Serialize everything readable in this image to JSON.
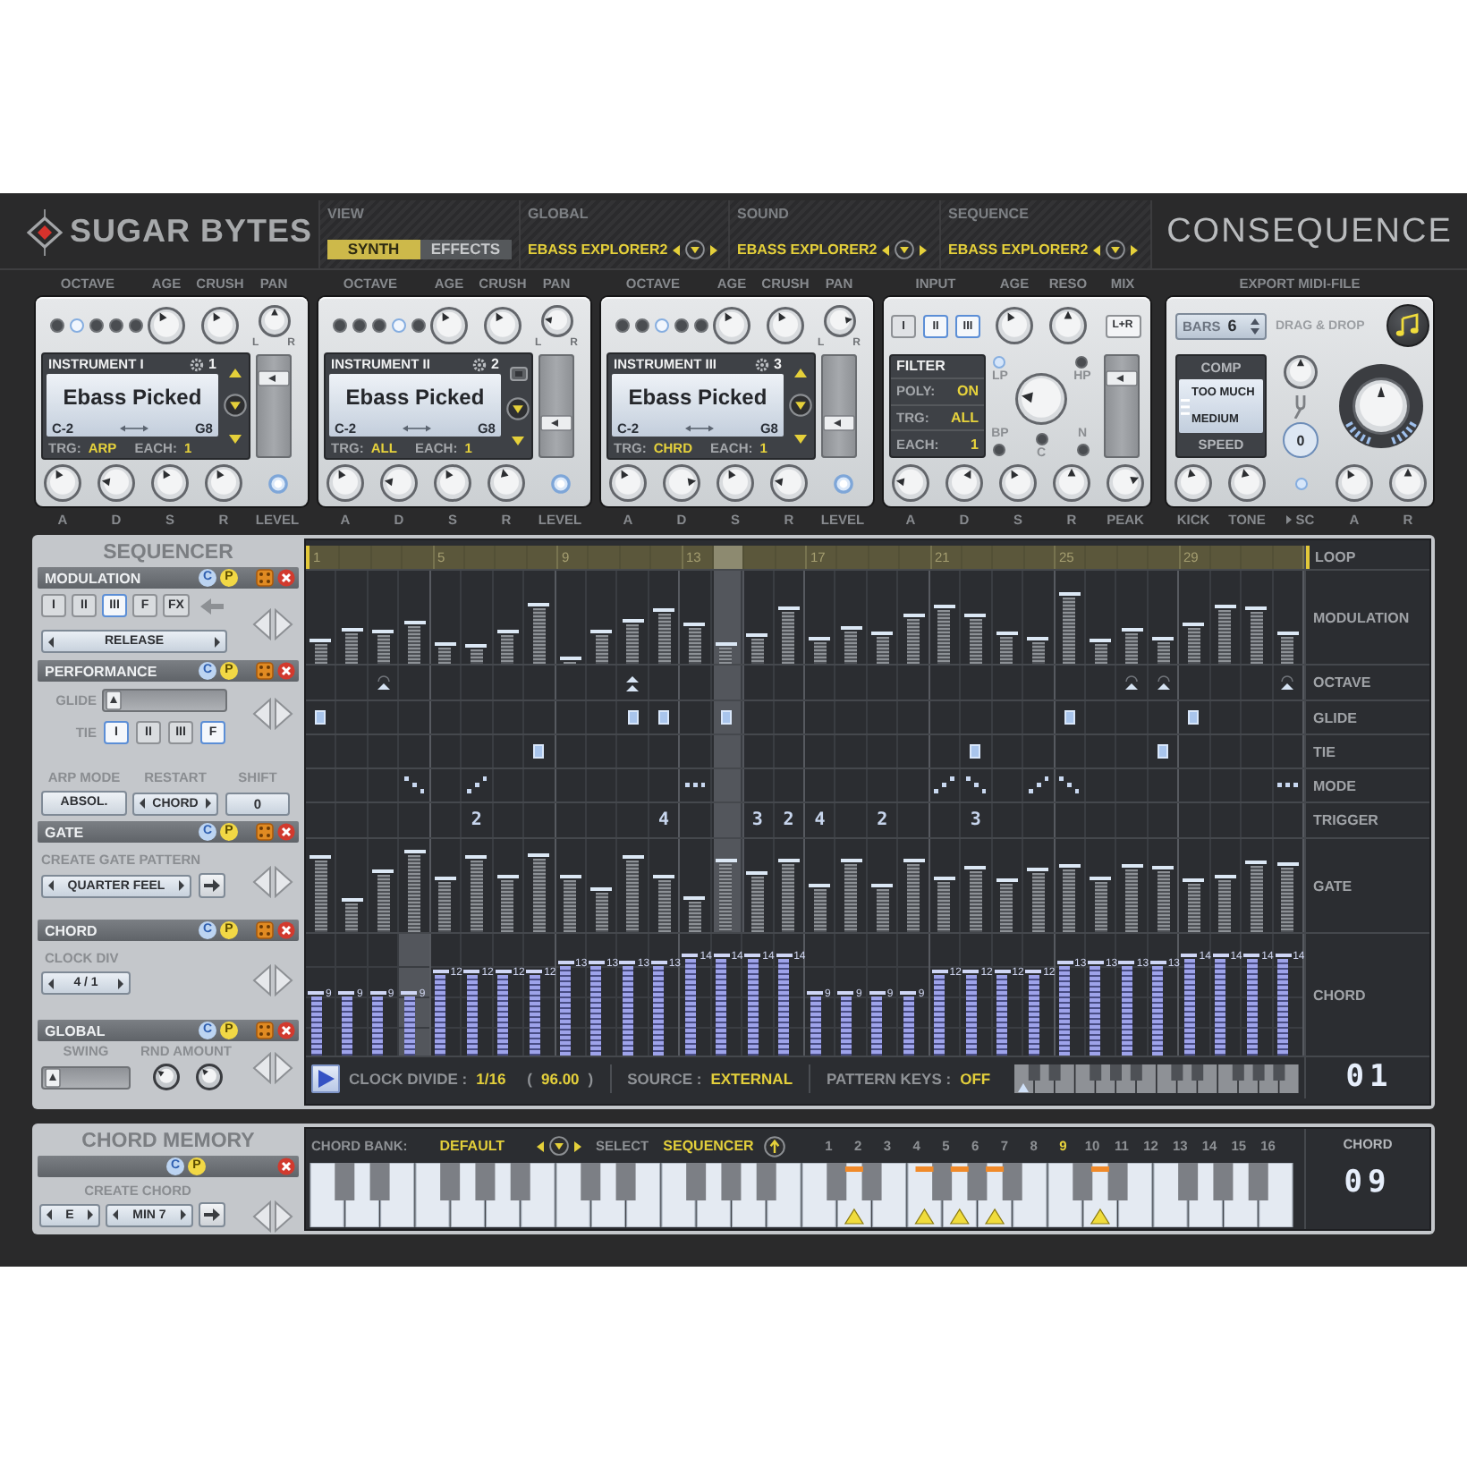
{
  "header": {
    "brand": "SUGAR BYTES",
    "view": {
      "label": "VIEW",
      "tabs": [
        {
          "label": "SYNTH",
          "selected": true
        },
        {
          "label": "EFFECTS",
          "selected": false
        }
      ]
    },
    "presets": [
      {
        "label": "GLOBAL",
        "value": "EBASS EXPLORER2"
      },
      {
        "label": "SOUND",
        "value": "EBASS EXPLORER2"
      },
      {
        "label": "SEQUENCE",
        "value": "EBASS EXPLORER2"
      }
    ],
    "product": "CONSEQUENCE"
  },
  "instruments": [
    {
      "octave_label": "OCTAVE",
      "octave_leds": [
        {
          "selected": false
        },
        {
          "selected": true
        },
        {
          "selected": false
        },
        {
          "selected": false
        },
        {
          "selected": false
        }
      ],
      "top_knobs": [
        {
          "label": "AGE",
          "level": 0.4
        },
        {
          "label": "CRUSH",
          "level": 0.4
        },
        {
          "label": "PAN",
          "level": 0.5,
          "left": "L",
          "right": "R"
        }
      ],
      "name": "INSTRUMENT I",
      "channel": "1",
      "patch": "Ebass Picked",
      "range_low": "C-2",
      "range_high": "G8",
      "trg_label": "TRG:",
      "trg": "ARP",
      "each_label": "EACH:",
      "each": "1",
      "scroll_up_enabled": true,
      "level": 0.85,
      "level_label": "LEVEL",
      "bottom_knobs": [
        {
          "label": "A",
          "level": 0.4
        },
        {
          "label": "D",
          "level": 0.2
        },
        {
          "label": "S",
          "level": 0.4
        },
        {
          "label": "R",
          "level": 0.4
        }
      ]
    },
    {
      "octave_label": "OCTAVE",
      "octave_leds": [
        {
          "selected": false
        },
        {
          "selected": false
        },
        {
          "selected": false
        },
        {
          "selected": true
        },
        {
          "selected": false
        }
      ],
      "top_knobs": [
        {
          "label": "AGE",
          "level": 0.4
        },
        {
          "label": "CRUSH",
          "level": 0.4
        },
        {
          "label": "PAN",
          "level": 0.2,
          "left": "L",
          "right": "R"
        }
      ],
      "name": "INSTRUMENT II",
      "channel": "2",
      "patch": "Ebass Picked",
      "range_low": "C-2",
      "range_high": "G8",
      "trg_label": "TRG:",
      "trg": "ALL",
      "each_label": "EACH:",
      "each": "1",
      "scroll_up_enabled": false,
      "level": 0.3,
      "level_label": "LEVEL",
      "bottom_knobs": [
        {
          "label": "A",
          "level": 0.4
        },
        {
          "label": "D",
          "level": 0.2
        },
        {
          "label": "S",
          "level": 0.4
        },
        {
          "label": "R",
          "level": 0.45
        }
      ]
    },
    {
      "octave_label": "OCTAVE",
      "octave_leds": [
        {
          "selected": false
        },
        {
          "selected": false
        },
        {
          "selected": true
        },
        {
          "selected": false
        },
        {
          "selected": false
        }
      ],
      "top_knobs": [
        {
          "label": "AGE",
          "level": 0.4
        },
        {
          "label": "CRUSH",
          "level": 0.4
        },
        {
          "label": "PAN",
          "level": 0.8,
          "left": "L",
          "right": "R"
        }
      ],
      "name": "INSTRUMENT III",
      "channel": "3",
      "patch": "Ebass Picked",
      "range_low": "C-2",
      "range_high": "G8",
      "trg_label": "TRG:",
      "trg": "CHRD",
      "each_label": "EACH:",
      "each": "1",
      "scroll_up_enabled": true,
      "level": 0.3,
      "level_label": "LEVEL",
      "bottom_knobs": [
        {
          "label": "A",
          "level": 0.4
        },
        {
          "label": "D",
          "level": 0.8
        },
        {
          "label": "S",
          "level": 0.4
        },
        {
          "label": "R",
          "level": 0.2
        }
      ]
    }
  ],
  "filter": {
    "input_label": "INPUT",
    "inputs": [
      {
        "label": "I",
        "selected": false
      },
      {
        "label": "II",
        "selected": true
      },
      {
        "label": "III",
        "selected": true
      }
    ],
    "top_knobs": [
      {
        "label": "AGE",
        "level": 0.4
      },
      {
        "label": "RESO",
        "level": 0.5
      }
    ],
    "mix_label": "MIX",
    "mix_button": "L+R",
    "title": "FILTER",
    "rows": [
      {
        "label": "POLY:",
        "value": "ON"
      },
      {
        "label": "TRG:",
        "value": "ALL"
      },
      {
        "label": "EACH:",
        "value": "1"
      }
    ],
    "modes": [
      {
        "label": "LP",
        "on": true
      },
      {
        "label": "HP",
        "on": false
      },
      {
        "label": "BP",
        "on": false
      },
      {
        "label": "N",
        "on": false
      },
      {
        "label": "C",
        "on": false
      }
    ],
    "cutoff": {
      "level": 0.2
    },
    "mix": {
      "level": 0.85
    },
    "bottom_knobs": [
      {
        "label": "A",
        "level": 0.2
      },
      {
        "label": "D",
        "level": 0.6
      },
      {
        "label": "S",
        "level": 0.4
      },
      {
        "label": "R",
        "level": 0.5
      },
      {
        "label": "PEAK",
        "level": 0.75
      }
    ]
  },
  "export": {
    "title": "EXPORT MIDI-FILE",
    "bars_label": "BARS",
    "bars": "6",
    "drag_label": "DRAG & DROP",
    "comp_label": "COMP",
    "comp": "TOO MUCH",
    "speed": "MEDIUM",
    "speed_label": "SPEED",
    "tune": {
      "level": 0.5
    },
    "tune_value": "0",
    "drive": {
      "level": 0.5
    },
    "bottom": [
      {
        "kind": "knob",
        "label": "KICK",
        "level": 0.45
      },
      {
        "kind": "knob",
        "label": "TONE",
        "level": 0.45
      },
      {
        "kind": "led",
        "label": "SC",
        "on": true
      },
      {
        "kind": "knob",
        "label": "A",
        "level": 0.4
      },
      {
        "kind": "knob",
        "label": "R",
        "level": 0.5
      }
    ]
  },
  "sequencer": {
    "title": "SEQUENCER",
    "sections": [
      {
        "kind": "modulation",
        "title": "MODULATION",
        "copy": "C",
        "paste": "P",
        "targets": [
          {
            "label": "I",
            "selected": false
          },
          {
            "label": "II",
            "selected": false
          },
          {
            "label": "III",
            "selected": true
          },
          {
            "label": "F",
            "selected": false
          },
          {
            "label": "FX",
            "selected": false
          }
        ],
        "parameter": "RELEASE"
      },
      {
        "kind": "performance",
        "title": "PERFORMANCE",
        "copy": "C",
        "paste": "P",
        "glide": {
          "label": "GLIDE",
          "level": 0.02
        },
        "tie": {
          "label": "TIE",
          "targets": [
            {
              "label": "I",
              "selected": true
            },
            {
              "label": "II",
              "selected": false
            },
            {
              "label": "III",
              "selected": false
            },
            {
              "label": "F",
              "selected": true
            }
          ]
        },
        "arp": {
          "mode_label": "ARP MODE",
          "mode": "ABSOL.",
          "restart_label": "RESTART",
          "restart": "CHORD",
          "shift_label": "SHIFT",
          "shift": "0"
        }
      },
      {
        "kind": "gate",
        "title": "GATE",
        "copy": "C",
        "paste": "P",
        "subtitle": "CREATE GATE PATTERN",
        "pattern": "QUARTER FEEL"
      },
      {
        "kind": "chord",
        "title": "CHORD",
        "copy": "C",
        "paste": "P",
        "subtitle": "CLOCK DIV",
        "clock_div": "4 / 1"
      },
      {
        "kind": "global",
        "title": "GLOBAL",
        "copy": "C",
        "paste": "P",
        "swing": {
          "label": "SWING",
          "level": 0.02
        },
        "rnd_label": "RND AMOUNT",
        "rnd_knobs": [
          {
            "level": 0.3
          },
          {
            "level": 0.35
          }
        ]
      }
    ],
    "grid": {
      "loop_label": "LOOP",
      "ruler": [
        {
          "number": "1",
          "playing": false
        },
        {
          "playing": false
        },
        {
          "playing": false
        },
        {
          "playing": false
        },
        {
          "number": "5",
          "playing": false
        },
        {
          "playing": false
        },
        {
          "playing": false
        },
        {
          "playing": false
        },
        {
          "number": "9",
          "playing": false
        },
        {
          "playing": false
        },
        {
          "playing": false
        },
        {
          "playing": false
        },
        {
          "number": "13",
          "playing": false
        },
        {
          "playing": true
        },
        {
          "playing": false
        },
        {
          "playing": false
        },
        {
          "number": "17",
          "playing": false
        },
        {
          "playing": false
        },
        {
          "playing": false
        },
        {
          "playing": false
        },
        {
          "number": "21",
          "playing": false
        },
        {
          "playing": false
        },
        {
          "playing": false
        },
        {
          "playing": false
        },
        {
          "number": "25",
          "playing": false
        },
        {
          "playing": false
        },
        {
          "playing": false
        },
        {
          "playing": false
        },
        {
          "number": "29",
          "playing": false
        },
        {
          "playing": false
        },
        {
          "playing": false
        },
        {
          "playing": false
        }
      ],
      "rows": [
        {
          "kind": "bars",
          "label": "MODULATION",
          "steps": [
            {
              "level": 0.26
            },
            {
              "level": 0.39
            },
            {
              "level": 0.36
            },
            {
              "level": 0.47
            },
            {
              "level": 0.23
            },
            {
              "level": 0.21
            },
            {
              "level": 0.37
            },
            {
              "level": 0.66
            },
            {
              "level": 0.07
            },
            {
              "level": 0.36
            },
            {
              "level": 0.48
            },
            {
              "level": 0.59
            },
            {
              "level": 0.45
            },
            {
              "level": 0.23
            },
            {
              "level": 0.33
            },
            {
              "level": 0.62
            },
            {
              "level": 0.29
            },
            {
              "level": 0.4
            },
            {
              "level": 0.34
            },
            {
              "level": 0.53
            },
            {
              "level": 0.63
            },
            {
              "level": 0.54
            },
            {
              "level": 0.34
            },
            {
              "level": 0.28
            },
            {
              "level": 0.76
            },
            {
              "level": 0.26
            },
            {
              "level": 0.39
            },
            {
              "level": 0.29
            },
            {
              "level": 0.45
            },
            {
              "level": 0.63
            },
            {
              "level": 0.62
            },
            {
              "level": 0.34
            }
          ]
        },
        {
          "kind": "octave",
          "label": "OCTAVE",
          "steps": [
            {
              "kind": "none"
            },
            {
              "kind": "none"
            },
            {
              "kind": "up"
            },
            {
              "kind": "none"
            },
            {
              "kind": "none"
            },
            {
              "kind": "none"
            },
            {
              "kind": "none"
            },
            {
              "kind": "none"
            },
            {
              "kind": "none"
            },
            {
              "kind": "none"
            },
            {
              "kind": "up2"
            },
            {
              "kind": "none"
            },
            {
              "kind": "none"
            },
            {
              "kind": "none"
            },
            {
              "kind": "none"
            },
            {
              "kind": "none"
            },
            {
              "kind": "none"
            },
            {
              "kind": "none"
            },
            {
              "kind": "none"
            },
            {
              "kind": "none"
            },
            {
              "kind": "none"
            },
            {
              "kind": "none"
            },
            {
              "kind": "none"
            },
            {
              "kind": "none"
            },
            {
              "kind": "none"
            },
            {
              "kind": "none"
            },
            {
              "kind": "up"
            },
            {
              "kind": "up"
            },
            {
              "kind": "none"
            },
            {
              "kind": "none"
            },
            {
              "kind": "none"
            },
            {
              "kind": "up"
            }
          ]
        },
        {
          "kind": "toggle",
          "label": "GLIDE",
          "steps": [
            {
              "on": true
            },
            {
              "on": false
            },
            {
              "on": false
            },
            {
              "on": false
            },
            {
              "on": false
            },
            {
              "on": false
            },
            {
              "on": false
            },
            {
              "on": false
            },
            {
              "on": false
            },
            {
              "on": false
            },
            {
              "on": true
            },
            {
              "on": true
            },
            {
              "on": false
            },
            {
              "on": true
            },
            {
              "on": false
            },
            {
              "on": false
            },
            {
              "on": false
            },
            {
              "on": false
            },
            {
              "on": false
            },
            {
              "on": false
            },
            {
              "on": false
            },
            {
              "on": false
            },
            {
              "on": false
            },
            {
              "on": false
            },
            {
              "on": true
            },
            {
              "on": false
            },
            {
              "on": false
            },
            {
              "on": false
            },
            {
              "on": true
            },
            {
              "on": false
            },
            {
              "on": false
            },
            {
              "on": false
            }
          ]
        },
        {
          "kind": "toggle",
          "label": "TIE",
          "steps": [
            {
              "on": false
            },
            {
              "on": false
            },
            {
              "on": false
            },
            {
              "on": false
            },
            {
              "on": false
            },
            {
              "on": false
            },
            {
              "on": false
            },
            {
              "on": true
            },
            {
              "on": false
            },
            {
              "on": false
            },
            {
              "on": false
            },
            {
              "on": false
            },
            {
              "on": false
            },
            {
              "on": false
            },
            {
              "on": false
            },
            {
              "on": false
            },
            {
              "on": false
            },
            {
              "on": false
            },
            {
              "on": false
            },
            {
              "on": false
            },
            {
              "on": false
            },
            {
              "on": true
            },
            {
              "on": false
            },
            {
              "on": false
            },
            {
              "on": false
            },
            {
              "on": false
            },
            {
              "on": false
            },
            {
              "on": true
            },
            {
              "on": false
            },
            {
              "on": false
            },
            {
              "on": false
            },
            {
              "on": false
            }
          ]
        },
        {
          "kind": "mode",
          "label": "MODE",
          "steps": [
            {
              "kind": "none"
            },
            {
              "kind": "none"
            },
            {
              "kind": "none"
            },
            {
              "kind": "down"
            },
            {
              "kind": "none"
            },
            {
              "kind": "up"
            },
            {
              "kind": "none"
            },
            {
              "kind": "none"
            },
            {
              "kind": "none"
            },
            {
              "kind": "none"
            },
            {
              "kind": "none"
            },
            {
              "kind": "none"
            },
            {
              "kind": "flat"
            },
            {
              "kind": "none"
            },
            {
              "kind": "none"
            },
            {
              "kind": "none"
            },
            {
              "kind": "none"
            },
            {
              "kind": "none"
            },
            {
              "kind": "none"
            },
            {
              "kind": "none"
            },
            {
              "kind": "up"
            },
            {
              "kind": "down"
            },
            {
              "kind": "none"
            },
            {
              "kind": "up"
            },
            {
              "kind": "down"
            },
            {
              "kind": "none"
            },
            {
              "kind": "none"
            },
            {
              "kind": "none"
            },
            {
              "kind": "none"
            },
            {
              "kind": "none"
            },
            {
              "kind": "none"
            },
            {
              "kind": "flat"
            }
          ]
        },
        {
          "kind": "trigger",
          "label": "TRIGGER",
          "steps": [
            {
              "kind": "none"
            },
            {
              "kind": "none"
            },
            {
              "kind": "none"
            },
            {
              "kind": "none"
            },
            {
              "kind": "none"
            },
            {
              "kind": "number",
              "value": "2"
            },
            {
              "kind": "none"
            },
            {
              "kind": "none"
            },
            {
              "kind": "none"
            },
            {
              "kind": "none"
            },
            {
              "kind": "none"
            },
            {
              "kind": "number",
              "value": "4"
            },
            {
              "kind": "none"
            },
            {
              "kind": "none"
            },
            {
              "kind": "number",
              "value": "3"
            },
            {
              "kind": "number",
              "value": "2"
            },
            {
              "kind": "number",
              "value": "4"
            },
            {
              "kind": "none"
            },
            {
              "kind": "number",
              "value": "2"
            },
            {
              "kind": "none"
            },
            {
              "kind": "none"
            },
            {
              "kind": "number",
              "value": "3"
            },
            {
              "kind": "none"
            },
            {
              "kind": "none"
            },
            {
              "kind": "none"
            },
            {
              "kind": "none"
            },
            {
              "kind": "none"
            },
            {
              "kind": "none"
            },
            {
              "kind": "none"
            },
            {
              "kind": "none"
            },
            {
              "kind": "none"
            },
            {
              "kind": "none"
            }
          ]
        },
        {
          "kind": "bars",
          "label": "GATE",
          "steps": [
            {
              "level": 0.82
            },
            {
              "level": 0.37
            },
            {
              "level": 0.67
            },
            {
              "level": 0.89
            },
            {
              "level": 0.59
            },
            {
              "level": 0.82
            },
            {
              "level": 0.62
            },
            {
              "level": 0.84
            },
            {
              "level": 0.62
            },
            {
              "level": 0.49
            },
            {
              "level": 0.82
            },
            {
              "level": 0.62
            },
            {
              "level": 0.39
            },
            {
              "level": 0.79
            },
            {
              "level": 0.65
            },
            {
              "level": 0.78
            },
            {
              "level": 0.51
            },
            {
              "level": 0.79
            },
            {
              "level": 0.52
            },
            {
              "level": 0.79
            },
            {
              "level": 0.59
            },
            {
              "level": 0.72
            },
            {
              "level": 0.57
            },
            {
              "level": 0.7
            },
            {
              "level": 0.73
            },
            {
              "level": 0.6
            },
            {
              "level": 0.73
            },
            {
              "level": 0.72
            },
            {
              "level": 0.57
            },
            {
              "level": 0.62
            },
            {
              "level": 0.76
            },
            {
              "level": 0.75
            }
          ]
        },
        {
          "kind": "chord",
          "label": "CHORD",
          "steps": [
            {
              "value": "9",
              "level": 0.53,
              "playing": false
            },
            {
              "value": "9",
              "level": 0.53,
              "playing": false
            },
            {
              "value": "9",
              "level": 0.53,
              "playing": false
            },
            {
              "value": "9",
              "level": 0.53,
              "playing": true
            },
            {
              "value": "12",
              "level": 0.7,
              "playing": false
            },
            {
              "value": "12",
              "level": 0.7,
              "playing": false
            },
            {
              "value": "12",
              "level": 0.7,
              "playing": false
            },
            {
              "value": "12",
              "level": 0.7,
              "playing": false
            },
            {
              "value": "13",
              "level": 0.78,
              "playing": false
            },
            {
              "value": "13",
              "level": 0.78,
              "playing": false
            },
            {
              "value": "13",
              "level": 0.78,
              "playing": false
            },
            {
              "value": "13",
              "level": 0.78,
              "playing": false
            },
            {
              "value": "14",
              "level": 0.84,
              "playing": false
            },
            {
              "value": "14",
              "level": 0.84,
              "playing": false
            },
            {
              "value": "14",
              "level": 0.84,
              "playing": false
            },
            {
              "value": "14",
              "level": 0.84,
              "playing": false
            },
            {
              "value": "9",
              "level": 0.53,
              "playing": false
            },
            {
              "value": "9",
              "level": 0.53,
              "playing": false
            },
            {
              "value": "9",
              "level": 0.53,
              "playing": false
            },
            {
              "value": "9",
              "level": 0.53,
              "playing": false
            },
            {
              "value": "12",
              "level": 0.7,
              "playing": false
            },
            {
              "value": "12",
              "level": 0.7,
              "playing": false
            },
            {
              "value": "12",
              "level": 0.7,
              "playing": false
            },
            {
              "value": "12",
              "level": 0.7,
              "playing": false
            },
            {
              "value": "13",
              "level": 0.78,
              "playing": false
            },
            {
              "value": "13",
              "level": 0.78,
              "playing": false
            },
            {
              "value": "13",
              "level": 0.78,
              "playing": false
            },
            {
              "value": "13",
              "level": 0.78,
              "playing": false
            },
            {
              "value": "14",
              "level": 0.84,
              "playing": false
            },
            {
              "value": "14",
              "level": 0.84,
              "playing": false
            },
            {
              "value": "14",
              "level": 0.84,
              "playing": false
            },
            {
              "value": "14",
              "level": 0.84,
              "playing": false
            }
          ]
        }
      ]
    },
    "footer": {
      "clock_label": "CLOCK DIVIDE :",
      "clock": "1/16",
      "tempo_open": "(",
      "tempo": "96.00",
      "tempo_close": ")",
      "source_label": "SOURCE :",
      "source": "EXTERNAL",
      "keys_label": "PATTERN KEYS :",
      "keys": "OFF",
      "pattern": "01"
    }
  },
  "chord_memory": {
    "title": "CHORD MEMORY",
    "copy": "C",
    "paste": "P",
    "create_label": "CREATE CHORD",
    "root": "E",
    "type": "MIN 7",
    "bank_label": "CHORD BANK:",
    "bank": "DEFAULT",
    "select_label": "SELECT",
    "select": "SEQUENCER",
    "slots": [
      {
        "label": "1",
        "selected": false
      },
      {
        "label": "2",
        "selected": false
      },
      {
        "label": "3",
        "selected": false
      },
      {
        "label": "4",
        "selected": false
      },
      {
        "label": "5",
        "selected": false
      },
      {
        "label": "6",
        "selected": false
      },
      {
        "label": "7",
        "selected": false
      },
      {
        "label": "8",
        "selected": false
      },
      {
        "label": "9",
        "selected": true
      },
      {
        "label": "10",
        "selected": false
      },
      {
        "label": "11",
        "selected": false
      },
      {
        "label": "12",
        "selected": false
      },
      {
        "label": "13",
        "selected": false
      },
      {
        "label": "14",
        "selected": false
      },
      {
        "label": "15",
        "selected": false
      },
      {
        "label": "16",
        "selected": false
      }
    ],
    "chord_label": "CHORD",
    "chord": "09",
    "keys": [
      {
        "marked": false
      },
      {
        "marked": false
      },
      {
        "marked": false
      },
      {
        "marked": false
      },
      {
        "marked": false
      },
      {
        "marked": false
      },
      {
        "marked": false
      },
      {
        "marked": false
      },
      {
        "marked": false
      },
      {
        "marked": false
      },
      {
        "marked": false
      },
      {
        "marked": false
      },
      {
        "marked": false
      },
      {
        "marked": false
      },
      {
        "marked": false
      },
      {
        "marked": true
      },
      {
        "marked": false
      },
      {
        "marked": true
      },
      {
        "marked": true
      },
      {
        "marked": true
      },
      {
        "marked": false
      },
      {
        "marked": false
      },
      {
        "marked": true
      },
      {
        "marked": false
      },
      {
        "marked": false
      },
      {
        "marked": false
      },
      {
        "marked": false
      },
      {
        "marked": false
      }
    ]
  }
}
